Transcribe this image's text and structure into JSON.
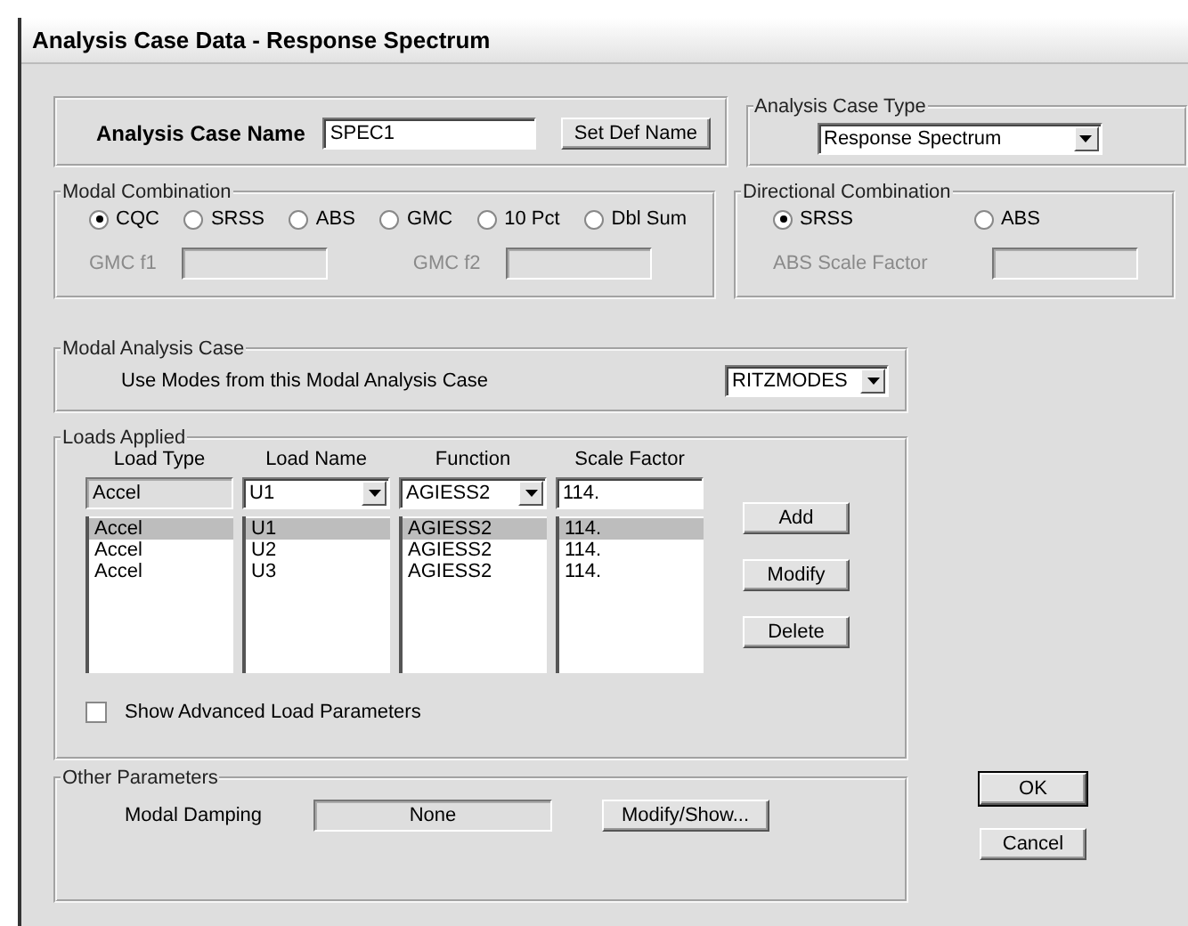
{
  "window": {
    "title": "Analysis Case Data - Response Spectrum"
  },
  "case_name": {
    "label": "Analysis Case Name",
    "value": "SPEC1",
    "button": "Set Def Name"
  },
  "case_type": {
    "label": "Analysis Case Type",
    "value": "Response Spectrum"
  },
  "modal_combination": {
    "label": "Modal Combination",
    "options": [
      {
        "label": "CQC",
        "selected": true
      },
      {
        "label": "SRSS",
        "selected": false
      },
      {
        "label": "ABS",
        "selected": false
      },
      {
        "label": "GMC",
        "selected": false
      },
      {
        "label": "10 Pct",
        "selected": false
      },
      {
        "label": "Dbl Sum",
        "selected": false
      }
    ],
    "fields": [
      {
        "label": "GMC f1",
        "disabled": true
      },
      {
        "label": "GMC f2",
        "disabled": true
      }
    ]
  },
  "directional_combination": {
    "label": "Directional Combination",
    "options": [
      {
        "label": "SRSS",
        "selected": true
      },
      {
        "label": "ABS",
        "selected": false
      }
    ],
    "field": {
      "label": "ABS Scale Factor",
      "disabled": true
    }
  },
  "modal_analysis_case": {
    "label": "Modal Analysis Case",
    "prompt": "Use Modes from this Modal Analysis Case",
    "value": "RITZMODES"
  },
  "loads_applied": {
    "label": "Loads Applied",
    "columns": [
      "Load Type",
      "Load Name",
      "Function",
      "Scale Factor"
    ],
    "editor": {
      "load_type": "Accel",
      "load_name": "U1",
      "function": "AGIESS2",
      "scale_factor": "114."
    },
    "rows": [
      {
        "load_type": "Accel",
        "load_name": "U1",
        "function": "AGIESS2",
        "scale_factor": "114.",
        "selected": true
      },
      {
        "load_type": "Accel",
        "load_name": "U2",
        "function": "AGIESS2",
        "scale_factor": "114.",
        "selected": false
      },
      {
        "load_type": "Accel",
        "load_name": "U3",
        "function": "AGIESS2",
        "scale_factor": "114.",
        "selected": false
      }
    ],
    "buttons": [
      "Add",
      "Modify",
      "Delete"
    ],
    "advanced": {
      "label": "Show Advanced Load Parameters",
      "checked": false
    }
  },
  "other_parameters": {
    "label": "Other Parameters",
    "damping_label": "Modal Damping",
    "damping_value": "None",
    "button": "Modify/Show..."
  },
  "buttons": [
    {
      "label": "OK",
      "default": true
    },
    {
      "label": "Cancel",
      "default": false
    }
  ]
}
